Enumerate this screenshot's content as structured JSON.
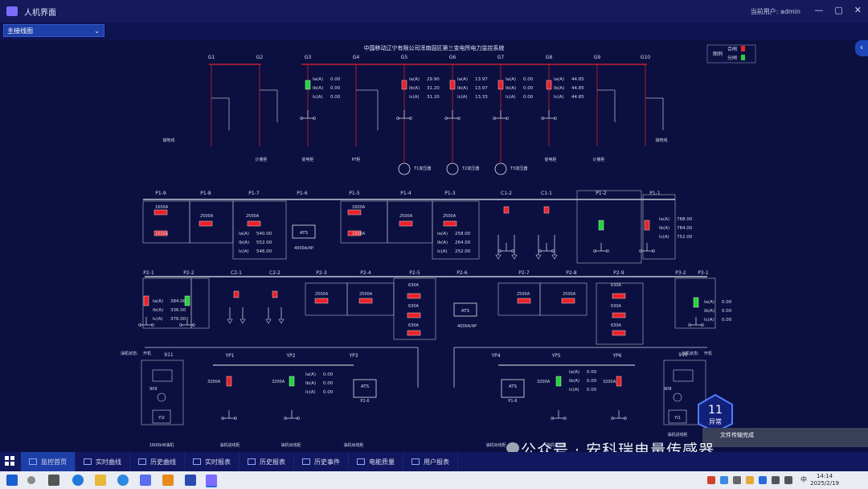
{
  "window": {
    "title": "人机界面",
    "user_label": "当前用户:",
    "user_name": "admin",
    "min": "—",
    "max": "▢",
    "close": "✕"
  },
  "toolbar": {
    "view_select": "主接线图",
    "caret": "⌄",
    "collapse": "‹"
  },
  "diagram": {
    "title": "中国移动辽宁有限公司浑南园区第三变电所电力监控系统",
    "legend": {
      "title": "图例",
      "closed": "合闸",
      "open": "分闸"
    },
    "top_labels": [
      "G1",
      "G2",
      "G3",
      "G4",
      "G5",
      "G6",
      "G7",
      "G8",
      "G9",
      "G10"
    ],
    "top_readings": [
      {
        "Ia": "0.00",
        "Ib": "0.00",
        "Ic": "0.00"
      },
      {
        "Ia": "29.90",
        "Ib": "31.20",
        "Ic": "31.20"
      },
      {
        "Ia": "13.97",
        "Ib": "13.97",
        "Ic": "13.33"
      },
      {
        "Ia": "0.00",
        "Ib": "0.00",
        "Ic": "0.00"
      },
      {
        "Ia": "44.85",
        "Ib": "44.85",
        "Ic": "44.85"
      }
    ],
    "phase_labels": [
      "Ia(A)",
      "Ib(A)",
      "Ic(A)"
    ],
    "cabinets": [
      "接地线",
      "计量柜",
      "受电柜",
      "PT柜",
      "受电柜",
      "计量柜",
      "接地线"
    ],
    "transformers": [
      "T1变压器",
      "T2变压器",
      "T3变压器"
    ],
    "p1_labels": [
      "P1-9",
      "P1-8",
      "P1-7",
      "P1-6",
      "P1-5",
      "P1-4",
      "P1-3",
      "C1-2",
      "C1-1",
      "P1-2",
      "P1-1"
    ],
    "p2_labels": [
      "P2-1",
      "P2-2",
      "C2-1",
      "C2-2",
      "P2-3",
      "P2-4",
      "P2-5",
      "P2-6",
      "P2-7",
      "P2-8",
      "P2-9",
      "P3-2",
      "P3-1"
    ],
    "ratings": {
      "r1600": "1600A",
      "r2500": "2500A",
      "r630": "630A",
      "r3200": "3200A",
      "r4000": "4000A/4P",
      "ats": "ATS"
    },
    "p1_readings": {
      "left": [
        "540.00",
        "552.00",
        "546.00"
      ],
      "mid": [
        "258.00",
        "264.00",
        "252.00"
      ],
      "right": [
        "768.00",
        "784.00",
        "752.00"
      ]
    },
    "p2_readings": {
      "left": [
        "384.00",
        "336.00",
        "376.00"
      ],
      "right": [
        "0.00",
        "0.00",
        "0.00"
      ]
    },
    "bottom_labels": [
      "YP1",
      "YP2",
      "YP3",
      "YP4",
      "YP5",
      "YP6",
      "911",
      "910"
    ],
    "gen_status_label": "油机状态:",
    "gen_status_value": "开机",
    "gen_readings": {
      "yp2": [
        "0.00",
        "0.00",
        "0.00"
      ],
      "yp5": [
        "0.00",
        "0.00",
        "0.00"
      ]
    },
    "gen_labels": [
      "1600kW油机",
      "油机进线柜",
      "油机出线柜",
      "油机出线柜",
      "油机出线柜",
      "油机进线柜",
      "油机进线柜"
    ],
    "panel_labels": {
      "p26": "P2-6",
      "p16": "P1-6",
      "yi2": "YI2",
      "yi1": "YI1",
      "g908": "908",
      "g909": "909"
    },
    "alarm": {
      "count": "11",
      "label": "异常"
    }
  },
  "nav": [
    "监控首页",
    "实时曲线",
    "历史曲线",
    "实时报表",
    "历史报表",
    "历史事件",
    "电能质量",
    "用户报表"
  ],
  "watermark": "公众号 · 安科瑞电量传感器",
  "toast": "文件传输完成",
  "clock": {
    "time": "14:14",
    "date": "2025/2/19",
    "lang": "中"
  },
  "colors": {
    "closed": "#e8222a",
    "open": "#22d43a",
    "bus": "#e8e8f0",
    "background": "#0b1040"
  }
}
